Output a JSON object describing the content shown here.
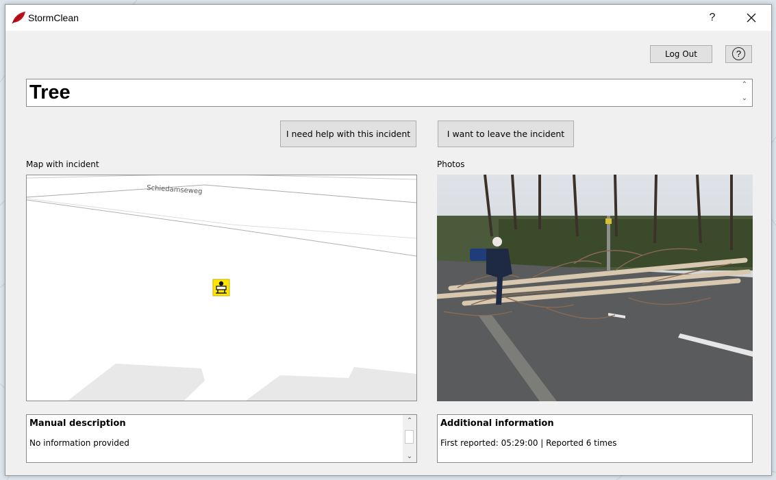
{
  "window": {
    "title": "StormClean",
    "help_symbol": "?",
    "close_symbol": "✕"
  },
  "header": {
    "logout_label": "Log Out",
    "help_label": "?"
  },
  "incident": {
    "title": "Tree"
  },
  "actions": {
    "need_help_label": "I need help with this incident",
    "leave_label": "I want to leave the incident"
  },
  "map": {
    "label": "Map with incident",
    "street_name": "Schiedamseweg",
    "marker_icon": "roadblock-icon"
  },
  "photos": {
    "label": "Photos"
  },
  "description": {
    "heading": "Manual description",
    "text": "No information provided"
  },
  "additional": {
    "heading": "Additional information",
    "text": "First reported: 05:29:00 | Reported 6 times"
  },
  "colors": {
    "accent": "#c0101c",
    "window_bg": "#f0f0f0",
    "marker_bg": "#ffe600"
  }
}
